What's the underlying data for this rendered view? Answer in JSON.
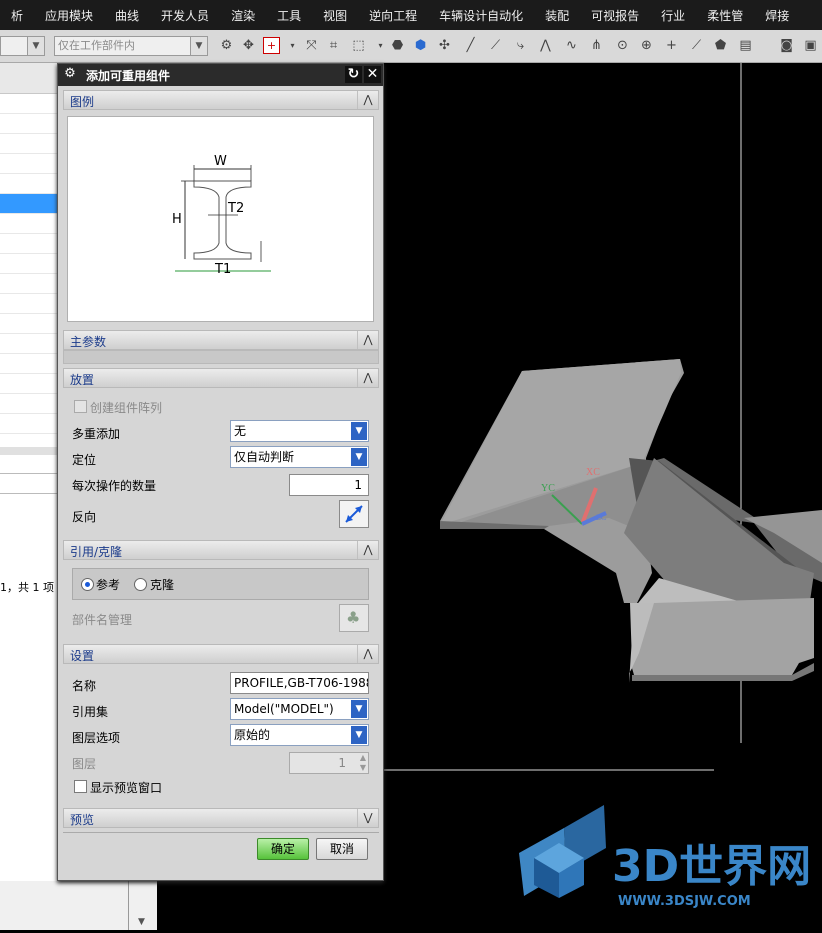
{
  "menu": [
    "析",
    "应用模块",
    "曲线",
    "开发人员",
    "渲染",
    "工具",
    "视图",
    "逆向工程",
    "车辆设计自动化",
    "装配",
    "可视报告",
    "行业",
    "柔性管",
    "焊接"
  ],
  "toolbar": {
    "filter_value": "仅在工作部件内"
  },
  "left_panel": {
    "status_text": "1，共 1 项"
  },
  "dialog": {
    "title": "添加可重用组件",
    "sections": {
      "legend": "图例",
      "main_params": "主参数",
      "placement": "放置",
      "reference_clone": "引用/克隆",
      "settings": "设置",
      "preview": "预览"
    },
    "legend_figure": {
      "w": "W",
      "h": "H",
      "t1": "T1",
      "t2": "T2"
    },
    "placement": {
      "create_array_label": "创建组件阵列",
      "multi_add_label": "多重添加",
      "multi_add_value": "无",
      "position_label": "定位",
      "position_value": "仅自动判断",
      "count_label": "每次操作的数量",
      "count_value": "1",
      "reverse_label": "反向"
    },
    "reference": {
      "reference_label": "参考",
      "clone_label": "克隆",
      "part_name_mgmt_label": "部件名管理"
    },
    "settings": {
      "name_label": "名称",
      "name_value": "PROFILE,GB-T706-1988",
      "refset_label": "引用集",
      "refset_value": "Model(\"MODEL\")",
      "layer_option_label": "图层选项",
      "layer_option_value": "原始的",
      "layer_label": "图层",
      "layer_value": "1",
      "show_preview_label": "显示预览窗口"
    },
    "ok_label": "确定",
    "cancel_label": "取消"
  },
  "viewport": {
    "axis_xc": "XC",
    "axis_yc": "YC",
    "axis_zc": "ZC"
  },
  "watermark": {
    "brand": "3D世界网",
    "url": "WWW.3DSJW.COM"
  }
}
